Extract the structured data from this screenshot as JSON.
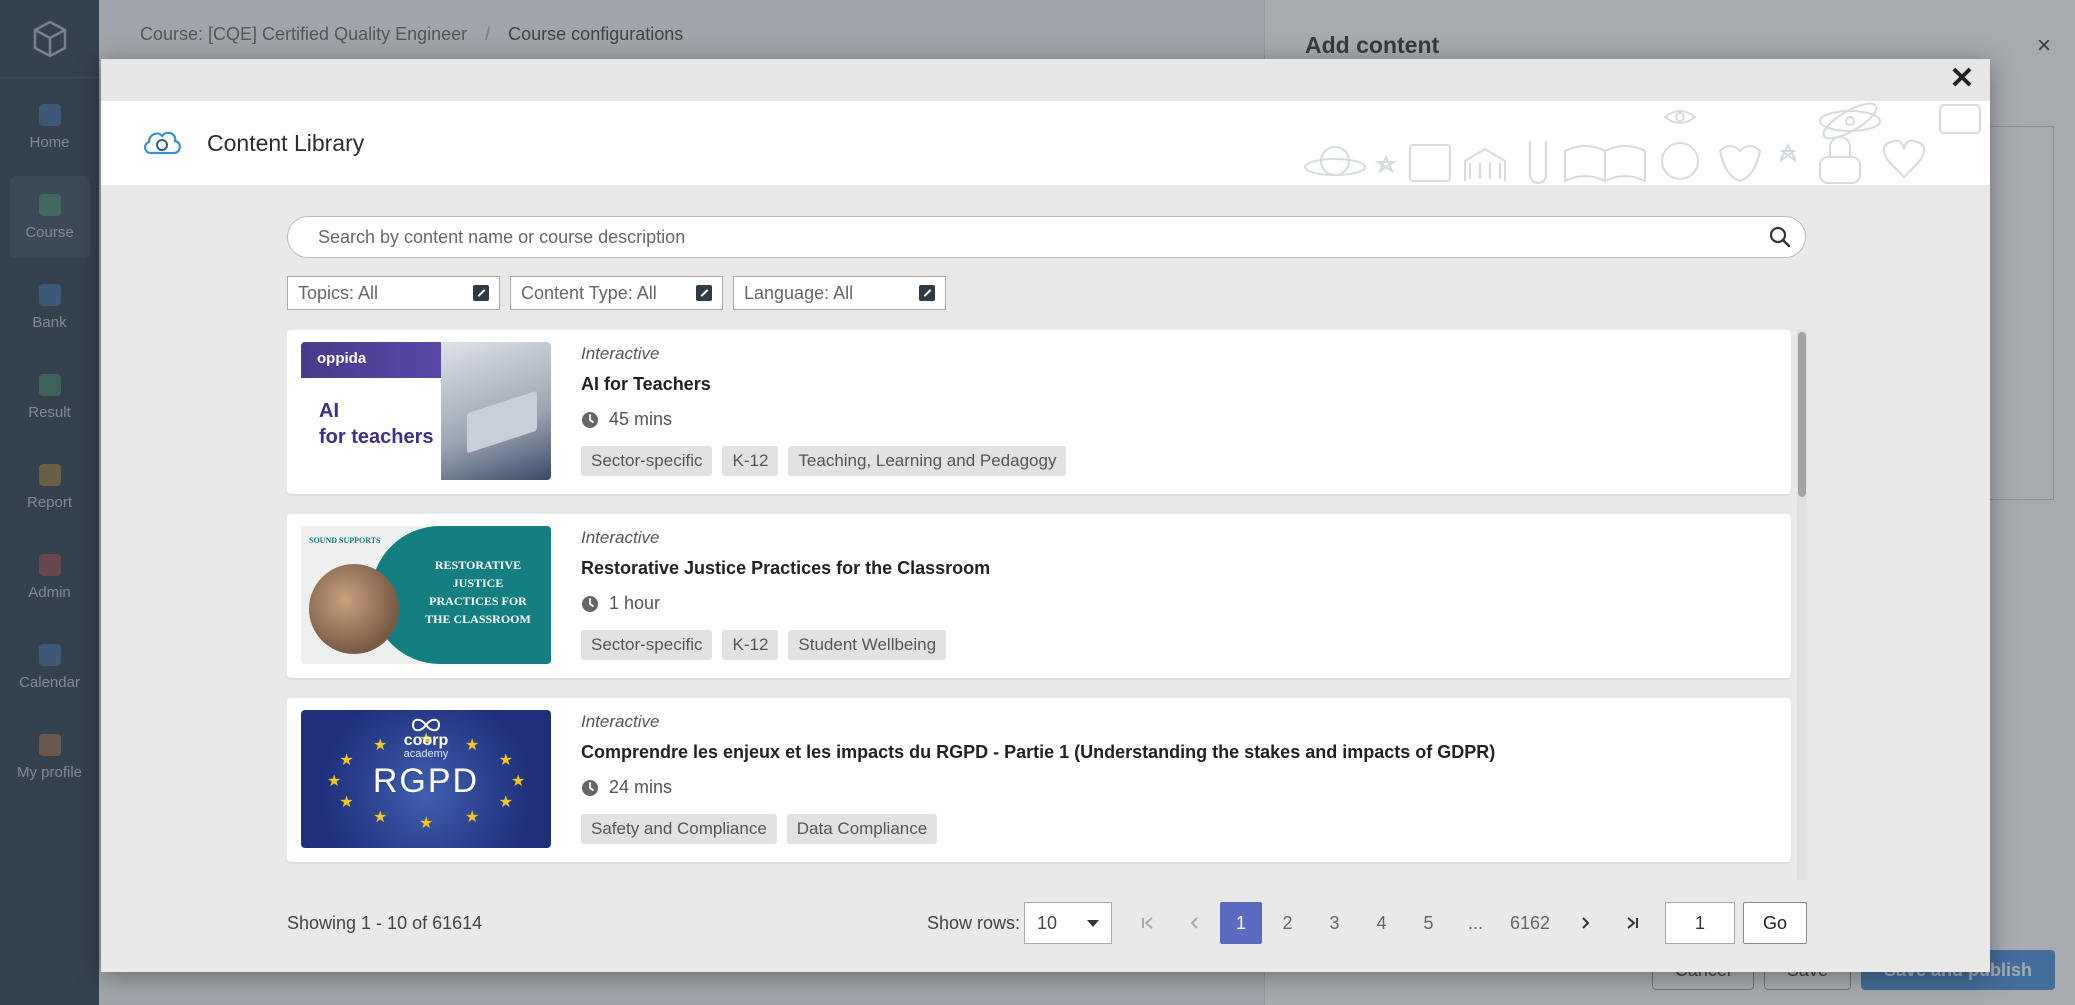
{
  "app": {
    "nav": [
      {
        "label": "Home",
        "color": "#4a8fd9"
      },
      {
        "label": "Course",
        "color": "#4cb07a"
      },
      {
        "label": "Bank",
        "color": "#4a8fd9"
      },
      {
        "label": "Result",
        "color": "#4cb07a"
      },
      {
        "label": "Report",
        "color": "#e0a030"
      },
      {
        "label": "Admin",
        "color": "#d9534f"
      },
      {
        "label": "Calendar",
        "color": "#4a8fd9"
      },
      {
        "label": "My profile",
        "color": "#e08a50"
      }
    ],
    "breadcrumb": {
      "course": "Course: [CQE] Certified Quality Engineer",
      "separator": "/",
      "current": "Course configurations"
    },
    "right_panel": {
      "title": "Add content",
      "close": "×",
      "cancel": "Cancel",
      "save": "Save",
      "save_publish": "Save and publish"
    }
  },
  "modal": {
    "close": "✕",
    "title": "Content Library",
    "search_placeholder": "Search by content name or course description",
    "filters": [
      {
        "label": "Topics: All"
      },
      {
        "label": "Content Type: All"
      },
      {
        "label": "Language: All"
      }
    ],
    "items": [
      {
        "type": "Interactive",
        "title": "AI for Teachers",
        "duration": "45 mins",
        "tags": [
          "Sector-specific",
          "K-12",
          "Teaching, Learning and Pedagogy"
        ],
        "thumb": {
          "brand": "oppida",
          "line1": "AI",
          "line2": "for teachers"
        }
      },
      {
        "type": "Interactive",
        "title": "Restorative Justice Practices for the Classroom",
        "duration": "1 hour",
        "tags": [
          "Sector-specific",
          "K-12",
          "Student Wellbeing"
        ],
        "thumb": {
          "brand": "SOUND SUPPORTS",
          "lines": [
            "RESTORATIVE",
            "JUSTICE",
            "PRACTICES FOR",
            "THE CLASSROOM"
          ]
        }
      },
      {
        "type": "Interactive",
        "title": "Comprendre les enjeux et les impacts du RGPD - Partie 1 (Understanding the stakes and impacts of GDPR)",
        "duration": "24 mins",
        "tags": [
          "Safety and Compliance",
          "Data Compliance"
        ],
        "thumb": {
          "brand": "coorp",
          "sub": "academy",
          "word": "RGPD"
        }
      }
    ],
    "footer": {
      "showing": "Showing 1 - 10 of 61614",
      "rows_label": "Show rows:",
      "rows_value": "10",
      "pages": [
        "1",
        "2",
        "3",
        "4",
        "5",
        "...",
        "6162"
      ],
      "current_page": "1",
      "go_value": "1",
      "go_label": "Go"
    }
  }
}
